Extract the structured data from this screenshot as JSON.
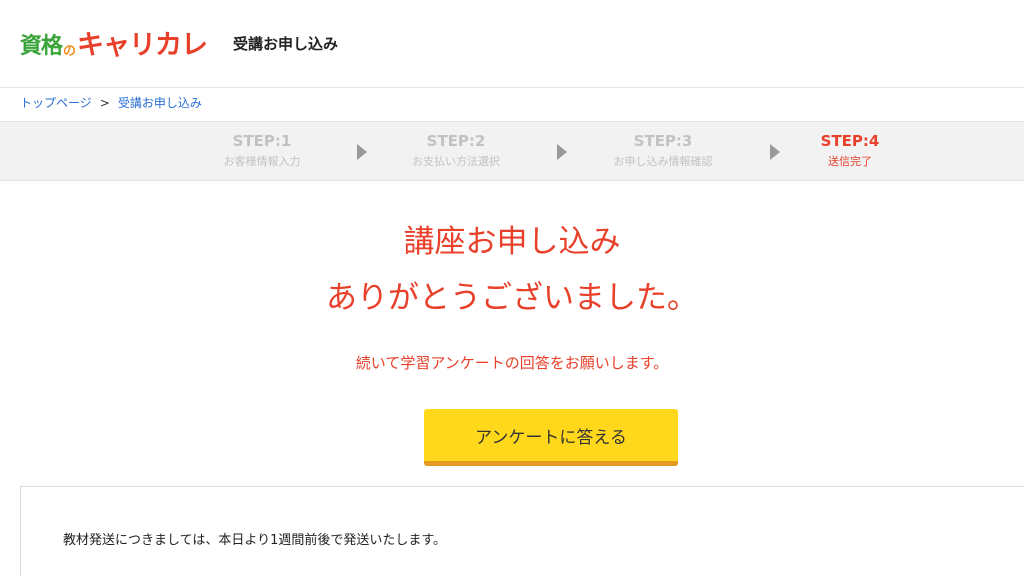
{
  "header": {
    "logo": {
      "part1": "資格",
      "part2": "の",
      "part3": "キャリカレ"
    },
    "title": "受講お申し込み"
  },
  "breadcrumb": {
    "items": [
      "トップページ",
      "受講お申し込み"
    ],
    "separator": ">"
  },
  "steps": [
    {
      "num": "STEP:1",
      "label": "お客様情報入力"
    },
    {
      "num": "STEP:2",
      "label": "お支払い方法選択"
    },
    {
      "num": "STEP:3",
      "label": "お申し込み情報確認"
    },
    {
      "num": "STEP:4",
      "label": "送信完了"
    }
  ],
  "current_step": 4,
  "thanks": {
    "line1": "講座お申し込み",
    "line2": "ありがとうございました。",
    "sub": "続いて学習アンケートの回答をお願いします。"
  },
  "survey_button": {
    "label": "アンケートに答える"
  },
  "notice": {
    "text": "教材発送につきましては、本日より1週間前後で発送いたします。"
  },
  "colors": {
    "accent": "#e8402a",
    "button": "#ffd81c",
    "button_shadow": "#e49a1e",
    "link": "#2a6fd6"
  }
}
